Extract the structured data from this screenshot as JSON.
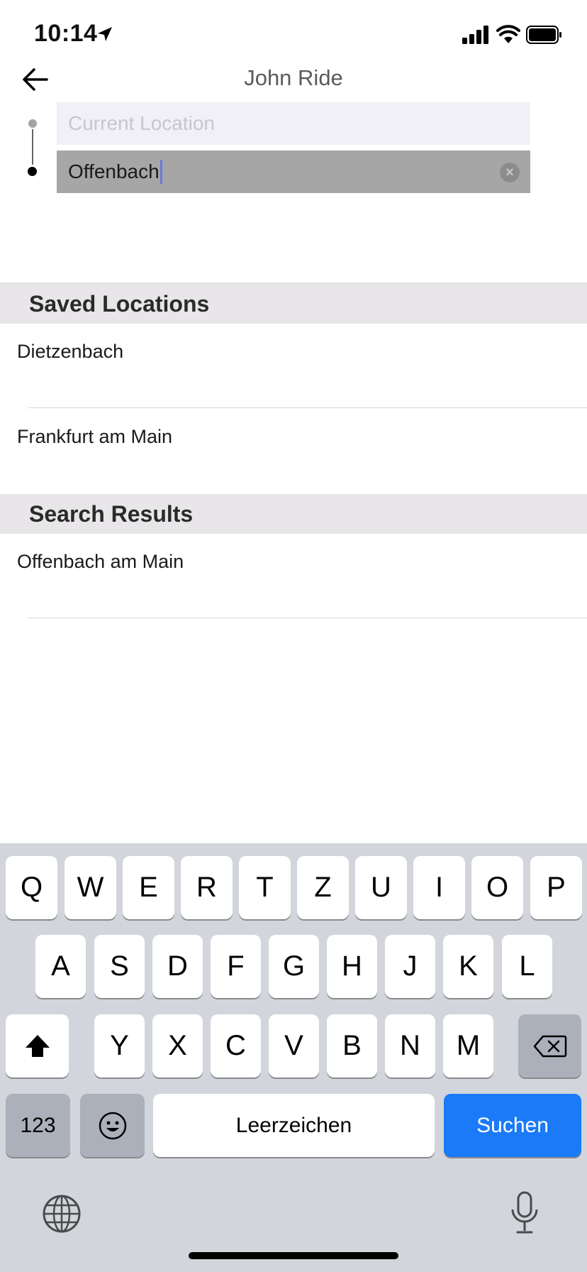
{
  "status_bar": {
    "time": "10:14",
    "icons": [
      "location-arrow-icon",
      "cellular-signal-icon",
      "wifi-icon",
      "battery-icon"
    ]
  },
  "header": {
    "title": "John Ride",
    "back_icon": "back-arrow-icon"
  },
  "route": {
    "from_placeholder": "Current Location",
    "from_value": "",
    "to_value": "Offenbach",
    "clear_icon": "clear-x-icon"
  },
  "sections": {
    "saved": {
      "title": "Saved Locations",
      "items": [
        "Dietzenbach",
        "Frankfurt am Main"
      ]
    },
    "results": {
      "title": "Search Results",
      "items": [
        "Offenbach am Main"
      ]
    }
  },
  "keyboard": {
    "row1": [
      "Q",
      "W",
      "E",
      "R",
      "T",
      "Z",
      "U",
      "I",
      "O",
      "P"
    ],
    "row2": [
      "A",
      "S",
      "D",
      "F",
      "G",
      "H",
      "J",
      "K",
      "L"
    ],
    "row3": [
      "Y",
      "X",
      "C",
      "V",
      "B",
      "N",
      "M"
    ],
    "numbers_label": "123",
    "space_label": "Leerzeichen",
    "action_label": "Suchen",
    "shift_icon": "shift-icon",
    "delete_icon": "backspace-icon",
    "emoji_icon": "emoji-icon",
    "globe_icon": "globe-icon",
    "mic_icon": "microphone-icon"
  },
  "colors": {
    "accent": "#1a7af8",
    "section_bg": "#e8e6e9",
    "keyboard_bg": "#d2d5db",
    "active_field_bg": "#a6a6a6"
  }
}
